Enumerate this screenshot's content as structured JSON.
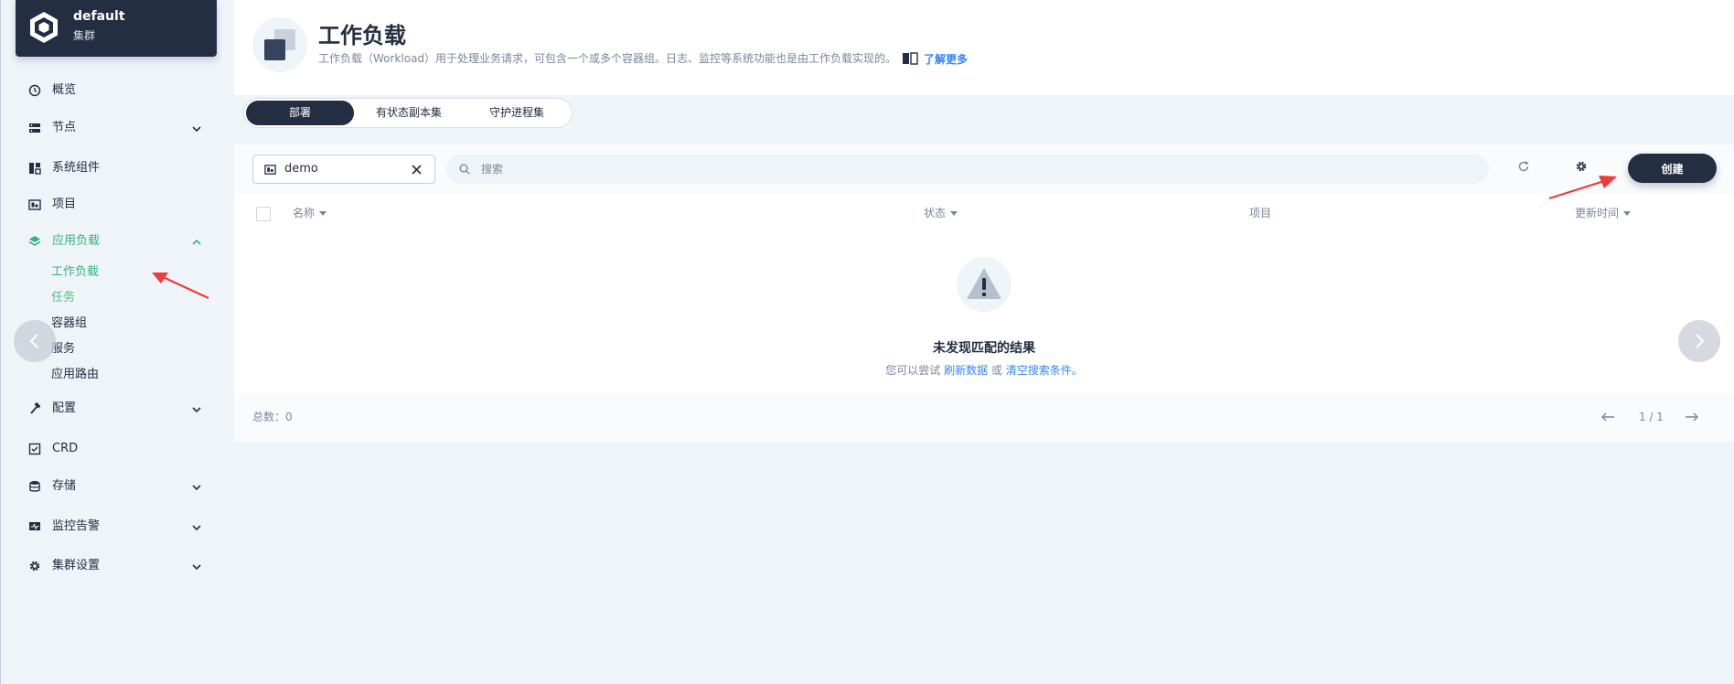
{
  "sidebar": {
    "cluster_name": "default",
    "cluster_type": "集群",
    "items": [
      {
        "label": "概览",
        "icon": "dashboard-icon"
      },
      {
        "label": "节点",
        "icon": "server-icon"
      },
      {
        "label": "系统组件",
        "icon": "components-icon"
      },
      {
        "label": "项目",
        "icon": "project-icon"
      },
      {
        "label": "应用负载",
        "icon": "layers-icon",
        "active": true
      },
      {
        "label": "配置",
        "icon": "hammer-icon"
      },
      {
        "label": "CRD",
        "icon": "crd-icon"
      },
      {
        "label": "存储",
        "icon": "database-icon"
      },
      {
        "label": "监控告警",
        "icon": "monitor-icon"
      },
      {
        "label": "集群设置",
        "icon": "gear-icon"
      }
    ],
    "sub_items": [
      "工作负载",
      "任务",
      "容器组",
      "服务",
      "应用路由"
    ]
  },
  "header": {
    "title": "工作负载",
    "description": "工作负载（Workload）用于处理业务请求，可包含一个或多个容器组。日志、监控等系统功能也是由工作负载实现的。",
    "learn_more": "了解更多"
  },
  "tabs": [
    {
      "label": "部署",
      "active": true
    },
    {
      "label": "有状态副本集",
      "active": false
    },
    {
      "label": "守护进程集",
      "active": false
    }
  ],
  "toolbar": {
    "namespace": "demo",
    "search_placeholder": "搜索",
    "create_label": "创建"
  },
  "table": {
    "columns": [
      "名称",
      "状态",
      "项目",
      "更新时间"
    ]
  },
  "empty": {
    "title": "未发现匹配的结果",
    "prefix": "您可以尝试",
    "refresh_link": "刷新数据",
    "or": "或",
    "clear_link": "清空搜索条件。"
  },
  "footer": {
    "total": "总数：0",
    "page": "1 / 1"
  },
  "colors": {
    "primary_dark": "#242e42",
    "accent_green": "#36b37e",
    "link_blue": "#3385ff",
    "annotation_red": "#ef3b3b"
  }
}
